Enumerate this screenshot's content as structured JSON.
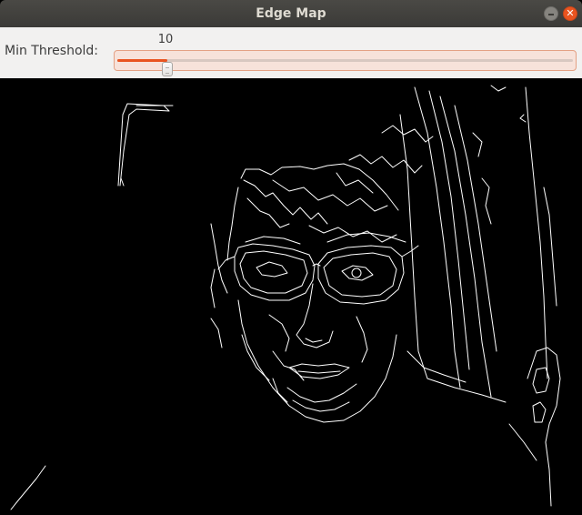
{
  "window": {
    "title": "Edge Map"
  },
  "controls": {
    "threshold_label": "Min Threshold:",
    "threshold_value": "10",
    "threshold_fraction": 0.11
  },
  "colors": {
    "accent": "#e95420",
    "titlebar": "#3b3a37",
    "panel": "#f2f1f0",
    "edges": "#ffffff"
  },
  "icons": {
    "minimize": "minimize-icon",
    "close": "close-icon"
  }
}
